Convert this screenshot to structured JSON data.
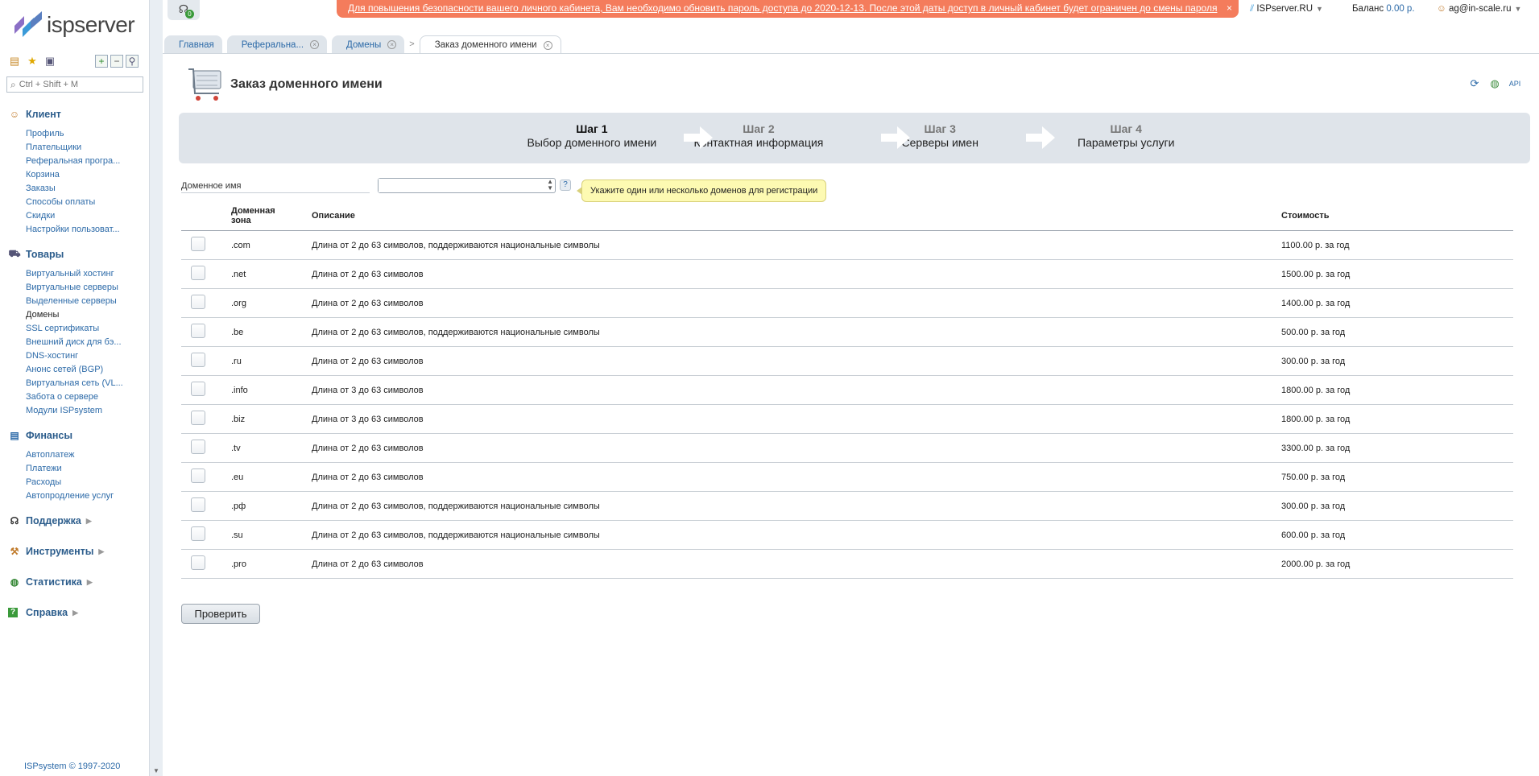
{
  "brand": {
    "logo_text": "ispserver",
    "logo_colors": [
      "#5a7fc0",
      "#3a9ad8",
      "#8b6fc6"
    ]
  },
  "notifications": {
    "count": "0"
  },
  "banner": {
    "message": "Для повышения безопасности вашего личного кабинета, Вам необходимо обновить пароль доступа до 2020-12-13. После этой даты доступ в личный кабинет будет ограничен до смены пароля",
    "close": "×"
  },
  "topbar": {
    "provider": "ISPserver.RU",
    "balance_label": "Баланс",
    "balance_value": "0.00 р.",
    "user": "ag@in-scale.ru"
  },
  "sidebar": {
    "search_placeholder": "Ctrl + Shift + M",
    "groups": [
      {
        "title": "Клиент",
        "icon": "user-icon",
        "items": [
          "Профиль",
          "Плательщики",
          "Реферальная програ...",
          "Корзина",
          "Заказы",
          "Способы оплаты",
          "Скидки",
          "Настройки пользоват..."
        ]
      },
      {
        "title": "Товары",
        "icon": "cart-icon",
        "items": [
          "Виртуальный хостинг",
          "Виртуальные серверы",
          "Выделенные серверы",
          "Домены",
          "SSL сертификаты",
          "Внешний диск для бэ...",
          "DNS-хостинг",
          "Анонс сетей (BGP)",
          "Виртуальная сеть (VL...",
          "Забота о сервере",
          "Модули ISPsystem"
        ]
      },
      {
        "title": "Финансы",
        "icon": "finance-icon",
        "items": [
          "Автоплатеж",
          "Платежи",
          "Расходы",
          "Автопродление услуг"
        ]
      }
    ],
    "collapsed": [
      {
        "title": "Поддержка",
        "icon": "headset-icon"
      },
      {
        "title": "Инструменты",
        "icon": "tools-icon"
      },
      {
        "title": "Статистика",
        "icon": "globe-icon"
      },
      {
        "title": "Справка",
        "icon": "help-icon"
      }
    ],
    "active_item": "Домены",
    "copyright": "ISPsystem © 1997-2020"
  },
  "tabs": [
    {
      "label": "Главная",
      "closable": false
    },
    {
      "label": "Реферальна...",
      "closable": true
    },
    {
      "label": "Домены",
      "closable": true
    },
    {
      "label": "Заказ доменного имени",
      "closable": true,
      "active": true
    }
  ],
  "page": {
    "title": "Заказ доменного имени"
  },
  "steps": [
    {
      "num": "Шаг 1",
      "label": "Выбор доменного имени",
      "current": true
    },
    {
      "num": "Шаг 2",
      "label": "Контактная информация"
    },
    {
      "num": "Шаг 3",
      "label": "Серверы имен"
    },
    {
      "num": "Шаг 4",
      "label": "Параметры услуги"
    }
  ],
  "form": {
    "domain_label": "Доменное имя",
    "domain_value": "",
    "help": "?",
    "tooltip": "Укажите один или несколько доменов для регистрации"
  },
  "table": {
    "headers": {
      "zone": "Доменная зона",
      "desc": "Описание",
      "cost": "Стоимость"
    },
    "rows": [
      {
        "zone": ".com",
        "desc": "Длина от 2 до 63 символов, поддерживаются национальные символы",
        "cost": "1100.00 р. за год"
      },
      {
        "zone": ".net",
        "desc": "Длина от 2 до 63 символов",
        "cost": "1500.00 р. за год"
      },
      {
        "zone": ".org",
        "desc": "Длина от 2 до 63 символов",
        "cost": "1400.00 р. за год"
      },
      {
        "zone": ".be",
        "desc": "Длина от 2 до 63 символов, поддерживаются национальные символы",
        "cost": "500.00 р. за год"
      },
      {
        "zone": ".ru",
        "desc": "Длина от 2 до 63 символов",
        "cost": "300.00 р. за год"
      },
      {
        "zone": ".info",
        "desc": "Длина от 3 до 63 символов",
        "cost": "1800.00 р. за год"
      },
      {
        "zone": ".biz",
        "desc": "Длина от 3 до 63 символов",
        "cost": "1800.00 р. за год"
      },
      {
        "zone": ".tv",
        "desc": "Длина от 2 до 63 символов",
        "cost": "3300.00 р. за год"
      },
      {
        "zone": ".eu",
        "desc": "Длина от 2 до 63 символов",
        "cost": "750.00 р. за год"
      },
      {
        "zone": ".рф",
        "desc": "Длина от 2 до 63 символов, поддерживаются национальные символы",
        "cost": "300.00 р. за год"
      },
      {
        "zone": ".su",
        "desc": "Длина от 2 до 63 символов, поддерживаются национальные символы",
        "cost": "600.00 р. за год"
      },
      {
        "zone": ".pro",
        "desc": "Длина от 2 до 63 символов",
        "cost": "2000.00 р. за год"
      }
    ]
  },
  "buttons": {
    "check": "Проверить"
  },
  "colors": {
    "accent": "#2c6aa8",
    "banner": "#f47c5c",
    "tooltip": "#fdfab2",
    "steps_bg": "#dfe4ea"
  }
}
